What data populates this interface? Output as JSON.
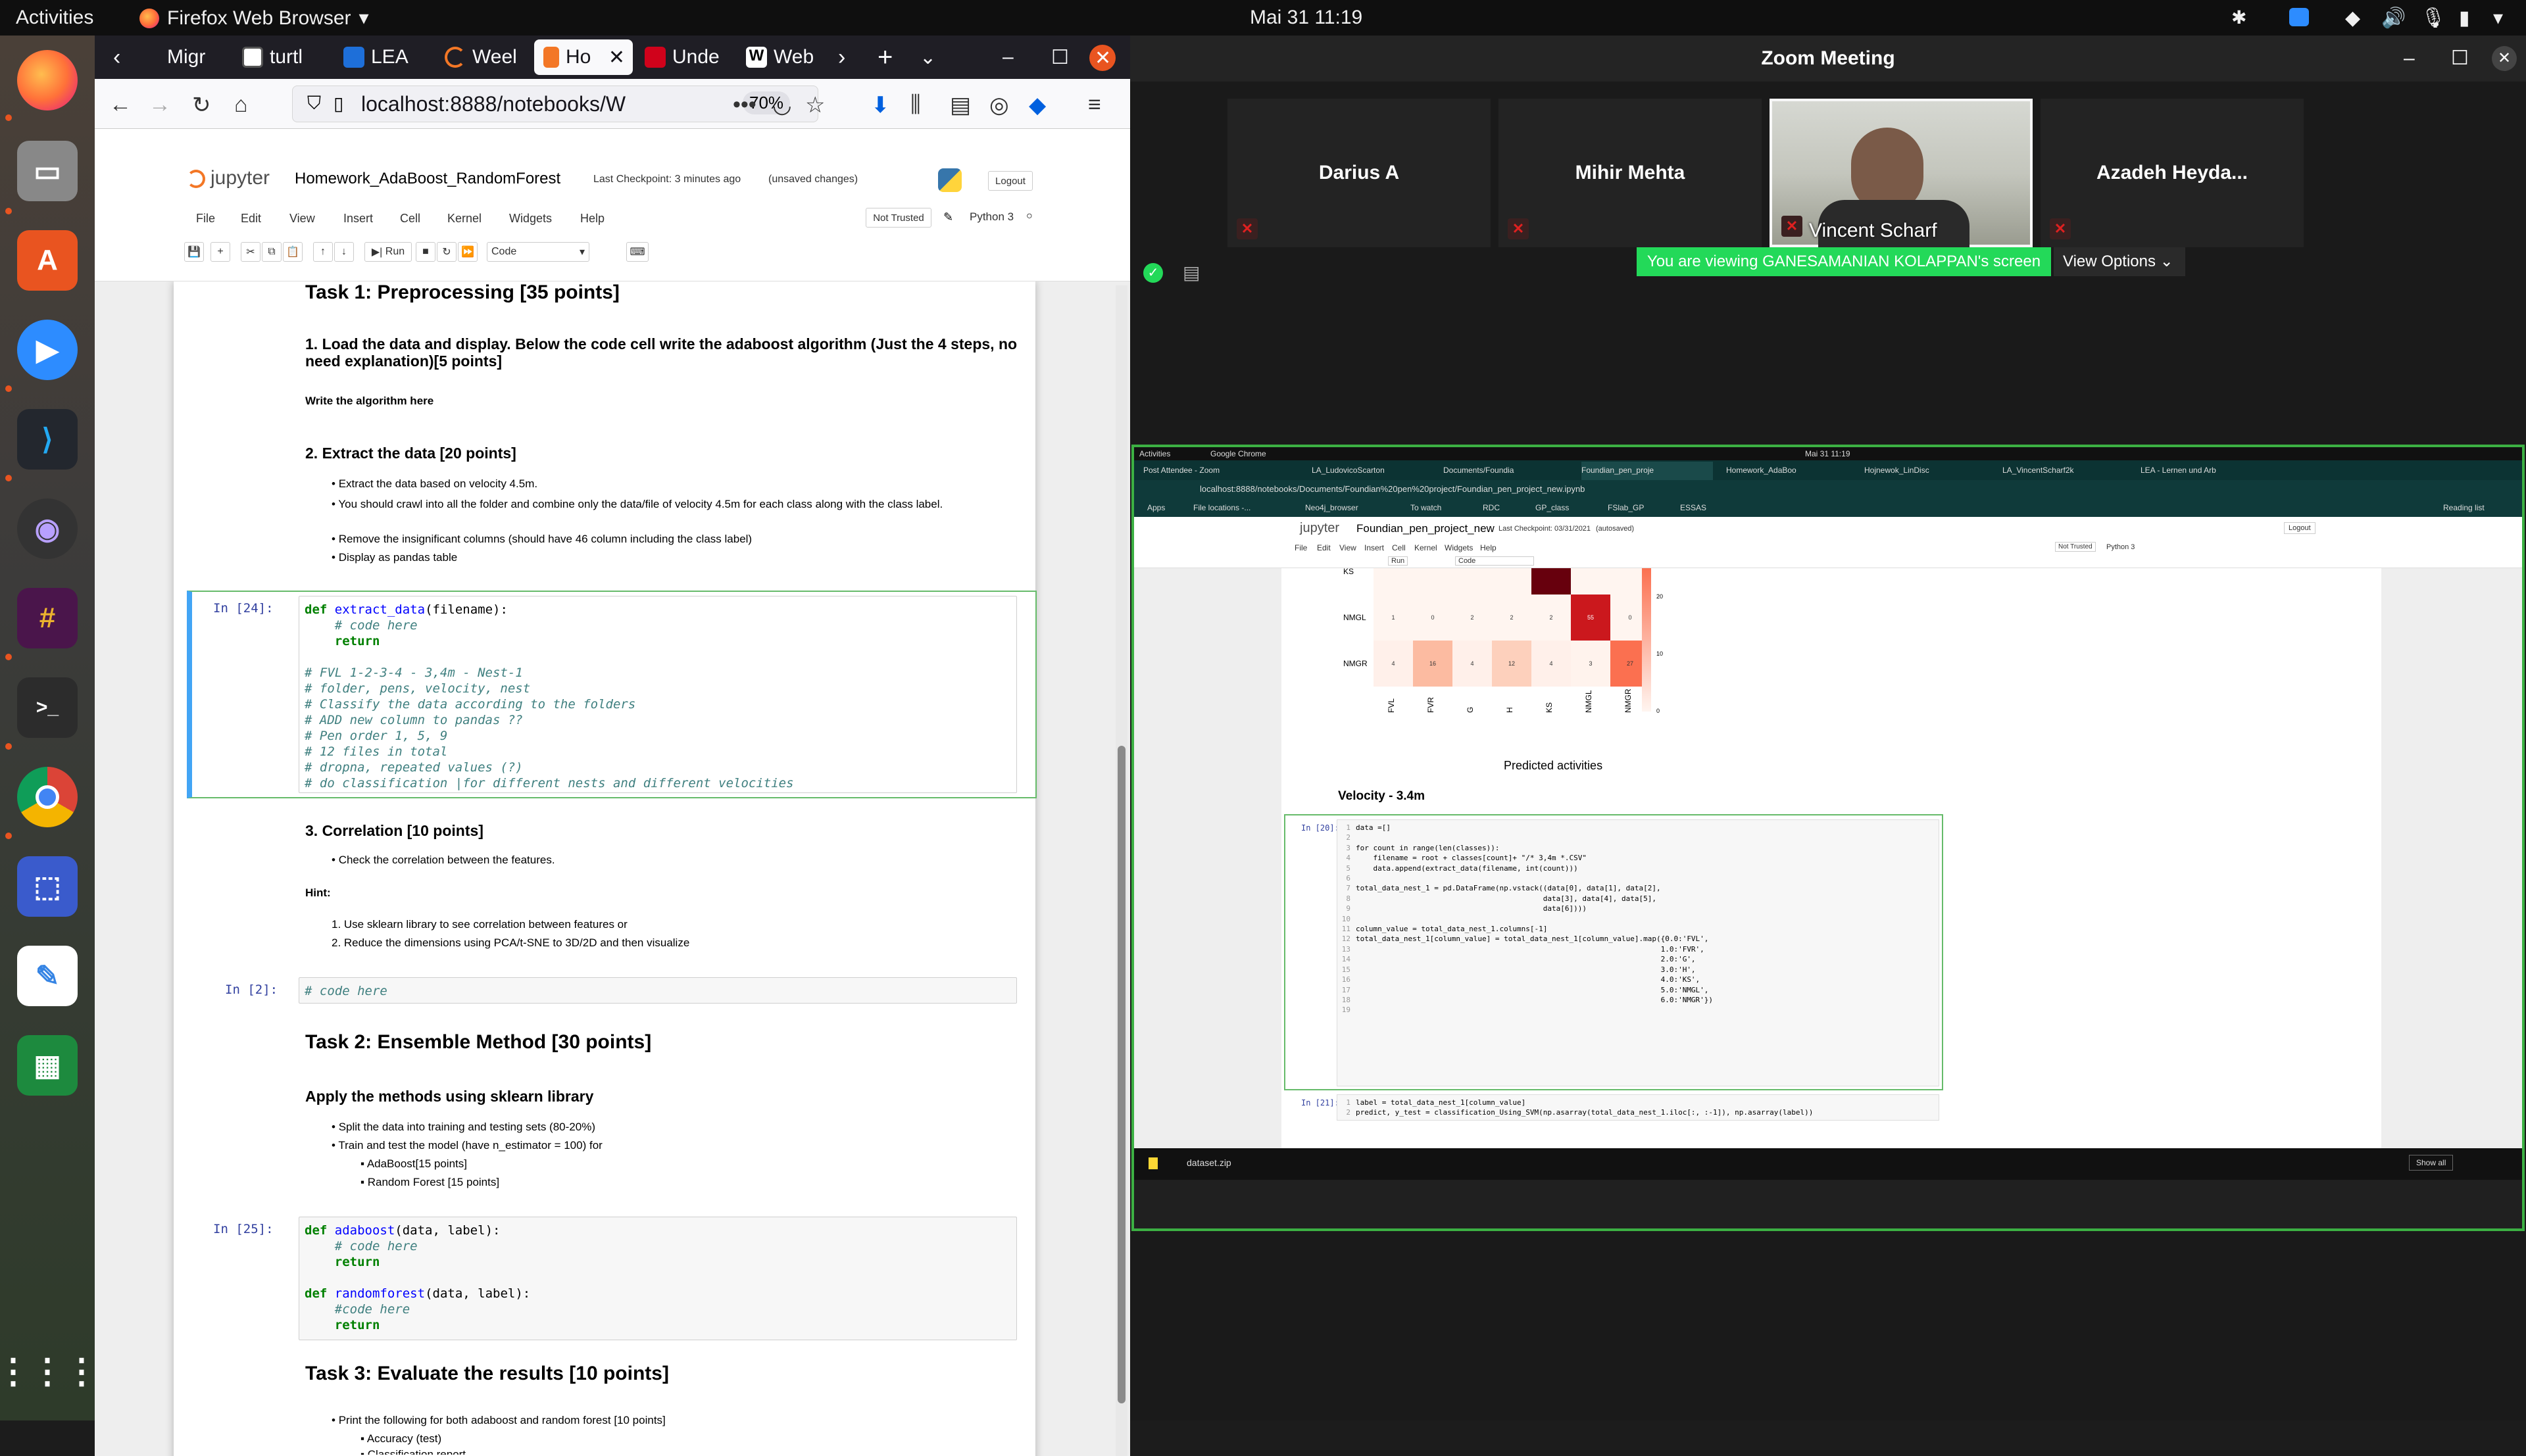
{
  "topbar": {
    "activities": "Activities",
    "app": "Firefox Web Browser",
    "clock": "Mai 31  11:19"
  },
  "dock": {
    "apps": [
      "firefox-icon",
      "files-icon",
      "software-icon",
      "zoom-icon",
      "vscode-icon",
      "screenshot-icon",
      "slack-icon",
      "terminal-icon",
      "chrome-icon",
      "selection-icon",
      "text-editor-icon",
      "spreadsheet-icon",
      "app-grid-icon"
    ]
  },
  "firefox": {
    "tabs": [
      "Migr",
      "turtl",
      "LEA",
      "Weel",
      "Ho",
      "Unde",
      "Web"
    ],
    "url": "localhost:8888/notebooks/W",
    "zoom": "70%"
  },
  "jupyter": {
    "logo": "jupyter",
    "title": "Homework_AdaBoost_RandomForest",
    "checkpoint": "Last Checkpoint: 3 minutes ago",
    "unsaved": "(unsaved changes)",
    "logout": "Logout",
    "menu": [
      "File",
      "Edit",
      "View",
      "Insert",
      "Cell",
      "Kernel",
      "Widgets",
      "Help"
    ],
    "trusted": "Not Trusted",
    "kernel": "Python 3",
    "run": "Run",
    "celltype": "Code"
  },
  "notebook": {
    "task1": "Task 1: Preprocessing [35 points]",
    "s1": "1. Load the data and display. Below the code cell write the adaboost algorithm (Just the 4 steps, no need explanation)[5 points]",
    "s1b": "Write the algorithm here",
    "s2": "2. Extract the data [20 points]",
    "s2_items": [
      "Extract the data based on velocity 4.5m.",
      "You should crawl into all the folder and combine only the data/file of velocity 4.5m for each class along with the class label.",
      "Remove the insignificant columns (should have 46 column including the class label)",
      "Display as pandas table"
    ],
    "p24": "In [24]:",
    "code24": [
      "def extract_data(filename):",
      "    # code here",
      "    return",
      "",
      "# FVL 1-2-3-4 - 3,4m - Nest-1",
      "# folder, pens, velocity, nest",
      "# Classify the data according to the folders",
      "# ADD new column to pandas ??",
      "# Pen order 1, 5, 9",
      "# 12 files in total",
      "# dropna, repeated values (?)",
      "# do classification for different nests and different velocities"
    ],
    "s3": "3. Correlation [10 points]",
    "s3_item": "Check the correlation between the features.",
    "hint": "Hint:",
    "hints": [
      "1. Use sklearn library to see correlation between features or",
      "2. Reduce the dimensions using PCA/t-SNE to 3D/2D and then visualize"
    ],
    "p2": "In [2]:",
    "code2": "# code here",
    "task2": "Task 2: Ensemble Method [30 points]",
    "apply": "Apply the methods using sklearn library",
    "t2_items": [
      "Split the data into training and testing sets (80-20%)",
      "Train and test the model (have n_estimator = 100) for"
    ],
    "t2_sub": [
      "AdaBoost[15 points]",
      "Random Forest [15 points]"
    ],
    "p25": "In [25]:",
    "code25": [
      "def adaboost(data, label):",
      "    # code here",
      "    return",
      "",
      "def randomforest(data, label):",
      "    #code here",
      "    return"
    ],
    "task3": "Task 3: Evaluate the results [10 points]",
    "t3_item": "Print the following for both adaboost and random forest [10 points]",
    "t3_sub": [
      "Accuracy (test)",
      "Classification report"
    ]
  },
  "zoom": {
    "title": "Zoom Meeting",
    "participants": [
      "Darius A",
      "Mihir Mehta",
      "Vincent Scharf",
      "Azadeh Heyda..."
    ],
    "viewing": "You are viewing GANESAMANIAN KOLAPPAN's screen",
    "view_options": "View Options"
  },
  "shared": {
    "activities": "Activities",
    "browser": "Google Chrome",
    "clock": "Mai 31  11:19",
    "tabs": [
      "Post Attendee - Zoom",
      "LA_LudovicoScarton",
      "Documents/Foundia",
      "Foundian_pen_proje",
      "Homework_AdaBoo",
      "Hojnewok_LinDisc",
      "LA_VincentScharf2k",
      "LEA - Lernen und Arb"
    ],
    "url": "localhost:8888/notebooks/Documents/Foundian%20pen%20project/Foundian_pen_project_new.ipynb",
    "bookmarks": [
      "Apps",
      "File locations -...",
      "Neo4j_browser",
      "To watch",
      "RDC",
      "GP_class",
      "FSlab_GP",
      "ESSAS"
    ],
    "reading_list": "Reading list",
    "nb_title": "Foundian_pen_project_new",
    "nb_checkpoint": "Last Checkpoint: 03/31/2021",
    "nb_autosaved": "(autosaved)",
    "logout": "Logout",
    "menu": [
      "File",
      "Edit",
      "View",
      "Insert",
      "Cell",
      "Kernel",
      "Widgets",
      "Help"
    ],
    "trusted": "Not Trusted",
    "kernel": "Python 3",
    "run": "Run",
    "celltype": "Code",
    "heat_rows": [
      {
        "label": "KS",
        "cells": [
          [
            "",
            "#fff5f0"
          ],
          [
            "",
            "#fff5f0"
          ],
          [
            "",
            "#fff5f0"
          ],
          [
            "",
            "#fff5f0"
          ],
          [
            "",
            "#67000d"
          ],
          [
            "",
            "#fff5f0"
          ],
          [
            "",
            "#fff5f0"
          ]
        ]
      },
      {
        "label": "NMGL",
        "cells": [
          [
            "1",
            "#fff5f0"
          ],
          [
            "0",
            "#fff5f0"
          ],
          [
            "2",
            "#fff5f0"
          ],
          [
            "2",
            "#fff5f0"
          ],
          [
            "2",
            "#fff5f0"
          ],
          [
            "55",
            "#cb181d"
          ],
          [
            "0",
            "#fff5f0"
          ]
        ]
      },
      {
        "label": "NMGR",
        "cells": [
          [
            "4",
            "#fff0ea"
          ],
          [
            "16",
            "#fcbba1"
          ],
          [
            "4",
            "#fff0ea"
          ],
          [
            "12",
            "#fdd0bc"
          ],
          [
            "4",
            "#fff0ea"
          ],
          [
            "3",
            "#fff3ed"
          ],
          [
            "27",
            "#fb7050"
          ]
        ]
      }
    ],
    "heat_cols": [
      "FVL",
      "FVR",
      "G",
      "H",
      "KS",
      "NMGL",
      "NMGR"
    ],
    "colorbar_ticks": [
      "20",
      "10",
      "0"
    ],
    "xlabel": "Predicted activities",
    "velocity": "Velocity - 3.4m",
    "p20": "In [20]:",
    "code20": [
      "data =[]",
      "",
      "for count in range(len(classes)):",
      "    filename = root + classes[count]+ \"/* 3,4m *.CSV\"",
      "    data.append(extract_data(filename, int(count)))",
      "",
      "total_data_nest_1 = pd.DataFrame(np.vstack((data[0], data[1], data[2],",
      "                                           data[3], data[4], data[5],",
      "                                           data[6])))",
      "",
      "column_value = total_data_nest_1.columns[-1]",
      "total_data_nest_1[column_value] = total_data_nest_1[column_value].map({0.0:'FVL',",
      "                                                                      1.0:'FVR',",
      "                                                                      2.0:'G',",
      "                                                                      3.0:'H',",
      "                                                                      4.0:'KS',",
      "                                                                      5.0:'NMGL',",
      "                                                                      6.0:'NMGR'})",
      ""
    ],
    "p21": "In [21]:",
    "code21": [
      "label = total_data_nest_1[column_value]",
      "predict, y_test = classification_Using_SVM(np.asarray(total_data_nest_1.iloc[:, :-1]), np.asarray(label))"
    ],
    "download": "dataset.zip",
    "show_all": "Show all"
  }
}
